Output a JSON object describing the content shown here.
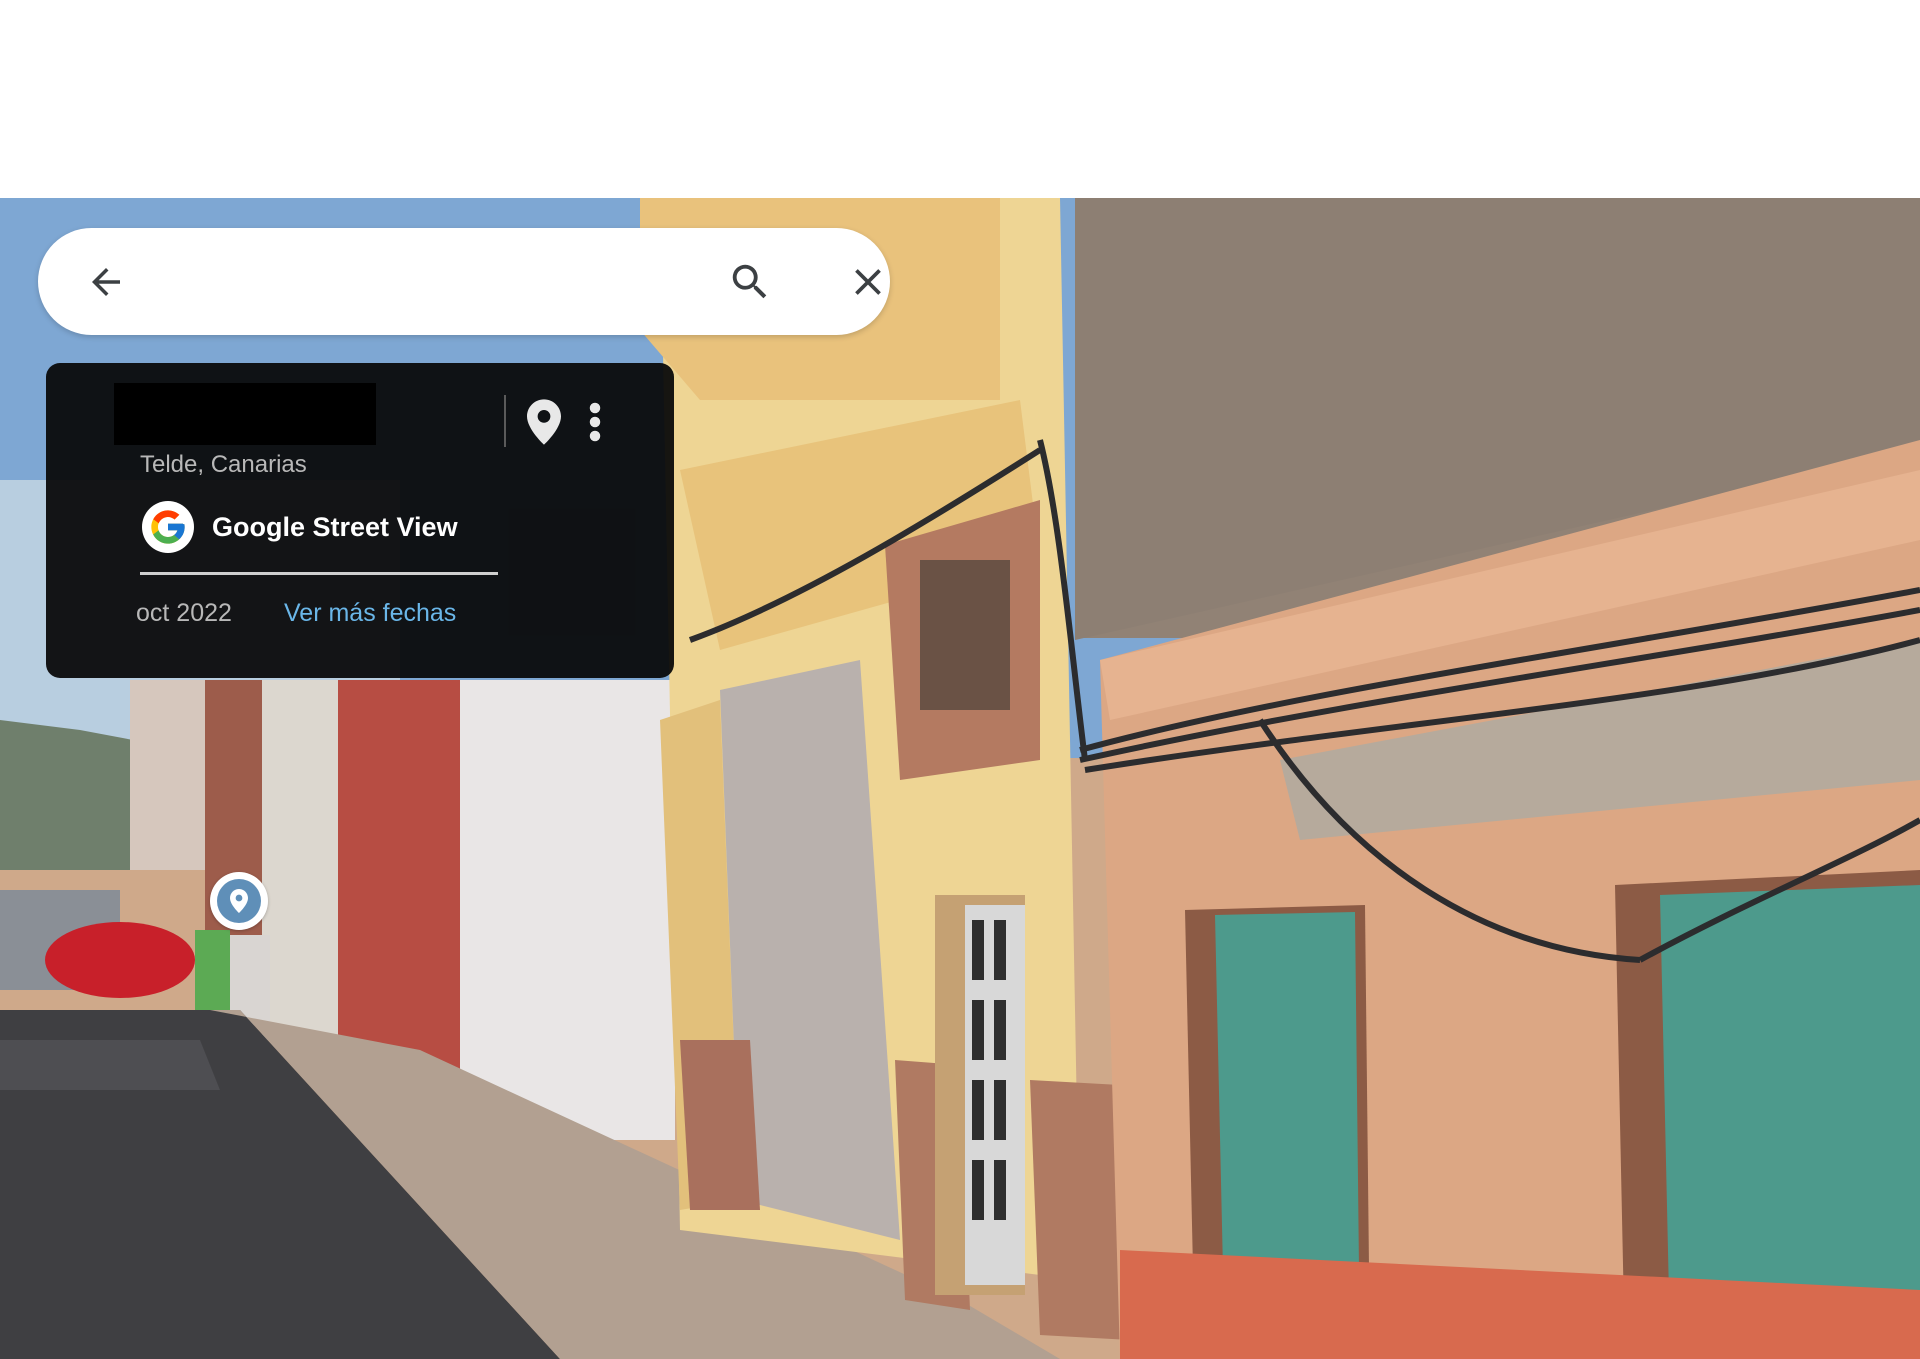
{
  "card": {
    "location": "Telde, Canarias",
    "source": "Google Street View",
    "date": "oct 2022",
    "more_dates_link": "Ver más fechas"
  },
  "colors": {
    "card_bg": "#080808",
    "link": "#6ab6e8",
    "wall_salmon": "#dca784",
    "door_teal": "#4d9a8c"
  },
  "icons": {
    "back": "arrow-left-icon",
    "search": "search-icon",
    "close": "close-icon",
    "pin": "map-pin-icon",
    "more": "more-vertical-icon",
    "google": "google-g-logo",
    "marker": "location-marker-icon"
  }
}
